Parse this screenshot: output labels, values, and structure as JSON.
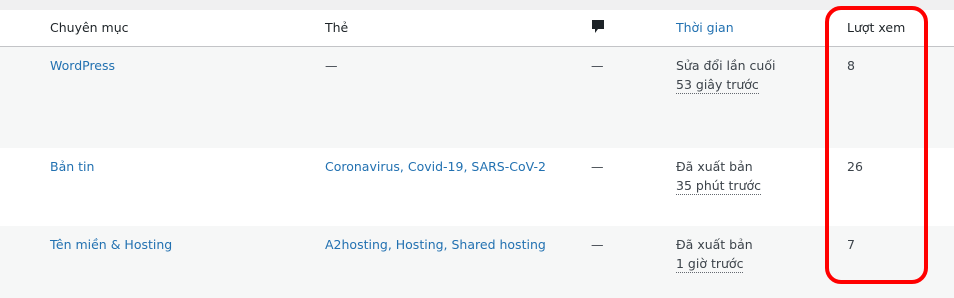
{
  "columns": {
    "category": "Chuyên mục",
    "tags": "Thẻ",
    "comments_icon": "comment-icon",
    "date": "Thời gian",
    "views": "Lượt xem"
  },
  "rows": [
    {
      "category": "WordPress",
      "tags": "—",
      "comments": "—",
      "date_status": "Sửa đổi lần cuối",
      "date_relative": "53 giây trước",
      "views": "8"
    },
    {
      "category": "Bản tin",
      "tags": "Coronavirus, Covid-19, SARS-CoV-2",
      "comments": "—",
      "date_status": "Đã xuất bản",
      "date_relative": "35 phút trước",
      "views": "26"
    },
    {
      "category": "Tên miền & Hosting",
      "tags": "A2hosting, Hosting, Shared hosting",
      "comments": "—",
      "date_status": "Đã xuất bản",
      "date_relative": "1 giờ trước",
      "views": "7"
    }
  ],
  "colors": {
    "link": "#2271b1",
    "highlight": "#ff0000",
    "row_alt": "#f6f7f7"
  }
}
